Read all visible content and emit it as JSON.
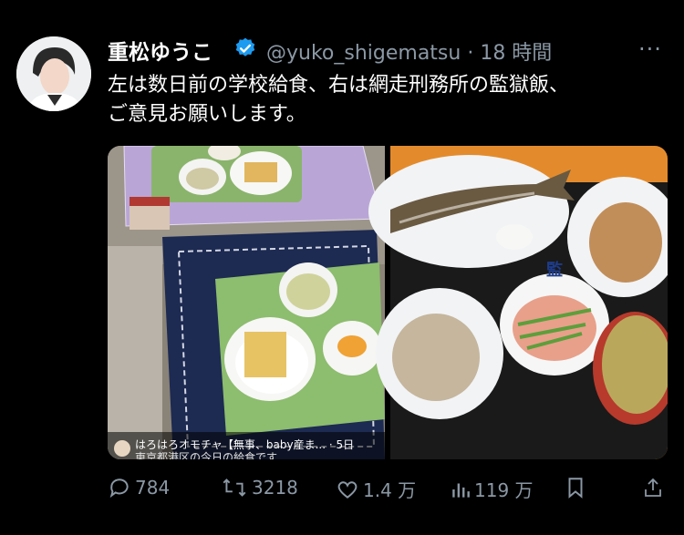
{
  "tweet": {
    "display_name": "重松ゆうこ",
    "handle_line": "@yuko_shigematsu · 18 時間",
    "more_icon": "more-icon",
    "text_line1": "左は数日前の学校給食、右は網走刑務所の監獄飯、",
    "text_line2": "ご意見お願いします。"
  },
  "media": {
    "left_caption": "はろはろオモチャ【無事、baby産ま... · 5日",
    "left_caption2": "東京都港区の今日の給食です",
    "bowl_mark": "監"
  },
  "actions": {
    "replies": "784",
    "retweets": "3218",
    "likes": "1.4 万",
    "views": "119 万"
  },
  "colors": {
    "background": "#000000",
    "muted": "#8b98a5",
    "verified": "#1d9bf0"
  }
}
